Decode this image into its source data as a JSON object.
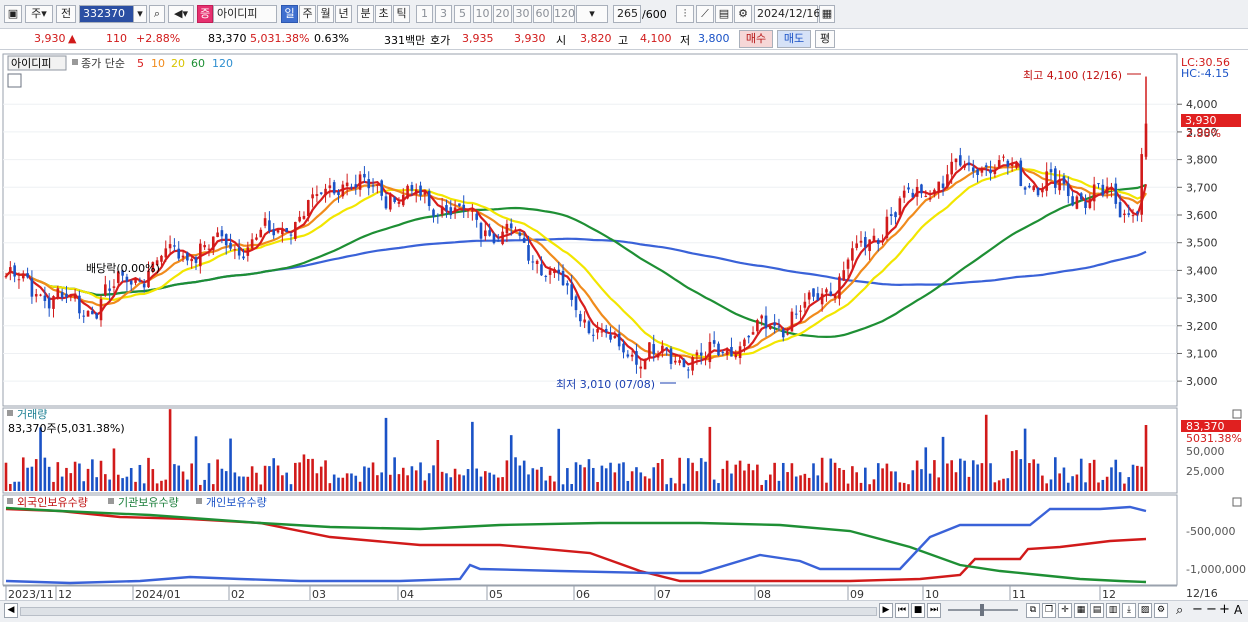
{
  "toolbar": {
    "market": "주",
    "mode": "전",
    "code": "332370",
    "stock_badge": "증",
    "stock_name": "아이디피",
    "periods": [
      "일",
      "주",
      "월",
      "년",
      "분",
      "초",
      "틱"
    ],
    "active_period": "일",
    "intervals": [
      "1",
      "3",
      "5",
      "10",
      "20",
      "30",
      "60",
      "120"
    ],
    "count": "265",
    "count_total": "/600",
    "date": "2024/12/16"
  },
  "quote": {
    "price": "3,930",
    "arrow": "▲",
    "change": "110",
    "change_pct": "+2.88%",
    "volume": "83,370",
    "volume_pct": "5,031.38%",
    "turnover": "0.63%",
    "amount": "331백만",
    "ask_label": "호가",
    "ask1": "3,935",
    "ask2": "3,930",
    "open_label": "시",
    "open": "3,820",
    "high_label": "고",
    "high": "4,100",
    "low_label": "저",
    "low": "3,800",
    "buy_label": "매수",
    "sell_label": "매도",
    "even_label": "평"
  },
  "legend": {
    "name": "아이디피",
    "kind": "종가 단순",
    "ma": [
      {
        "label": "5",
        "color": "#d81d1d"
      },
      {
        "label": "10",
        "color": "#f08b1c"
      },
      {
        "label": "20",
        "color": "#e0d000"
      },
      {
        "label": "60",
        "color": "#1e8f34"
      },
      {
        "label": "120",
        "color": "#2f8fd0"
      }
    ]
  },
  "price_panel": {
    "y_ticks": [
      "4,000",
      "3,900",
      "3,800",
      "3,700",
      "3,600",
      "3,500",
      "3,400",
      "3,300",
      "3,200",
      "3,100",
      "3,000"
    ],
    "lc": "LC:30.56",
    "hc": "HC:-4.15",
    "last_price": "3,930",
    "last_pct": "2.88%",
    "max_label": "최고 4,100 (12/16)",
    "min_label": "최저 3,010 (07/08)",
    "dividend_label": "배당락(0.00%)"
  },
  "volume_panel": {
    "title": "거래량",
    "summary": "83,370주(5,031.38%)",
    "last": "83,370",
    "last_pct": "5031.38%",
    "y_ticks": [
      "50,000",
      "25,000"
    ]
  },
  "holder_panel": {
    "series": [
      "외국인보유수량",
      "기관보유수량",
      "개인보유수량"
    ],
    "y_ticks": [
      "-500,000",
      "-1,000,000"
    ]
  },
  "x_axis": {
    "labels": [
      "2023/11",
      "12",
      "2024/01",
      "02",
      "03",
      "04",
      "05",
      "06",
      "07",
      "08",
      "09",
      "10",
      "11",
      "12"
    ],
    "last": "12/16"
  },
  "colors": {
    "up": "#d11a1a",
    "down": "#1a52c6",
    "ma5": "#d81d1d",
    "ma10": "#f08b1c",
    "ma20": "#f2e600",
    "ma60": "#1e8f34",
    "ma120": "#3a62d8"
  },
  "chart_data": {
    "type": "line",
    "x_range": [
      "2023/11",
      "2024/12/16"
    ],
    "ylim": [
      2950,
      4120
    ],
    "price_points": [
      [
        "2023/11",
        3380
      ],
      [
        "2023/12",
        3260
      ],
      [
        "2024/01",
        3460
      ],
      [
        "2024/02",
        3520
      ],
      [
        "2024/03",
        3720
      ],
      [
        "2024/04",
        3640
      ],
      [
        "2024/05",
        3490
      ],
      [
        "2024/06",
        3110
      ],
      [
        "2024/07",
        3080
      ],
      [
        "2024/08",
        3260
      ],
      [
        "2024/09",
        3640
      ],
      [
        "2024/10",
        3800
      ],
      [
        "2024/11",
        3700
      ],
      [
        "2024/12",
        3620
      ],
      [
        "2024/12/16",
        3930
      ]
    ],
    "high": 4100,
    "low": 3010,
    "series": [
      {
        "name": "5"
      },
      {
        "name": "10"
      },
      {
        "name": "20"
      },
      {
        "name": "60"
      },
      {
        "name": "120"
      }
    ]
  }
}
